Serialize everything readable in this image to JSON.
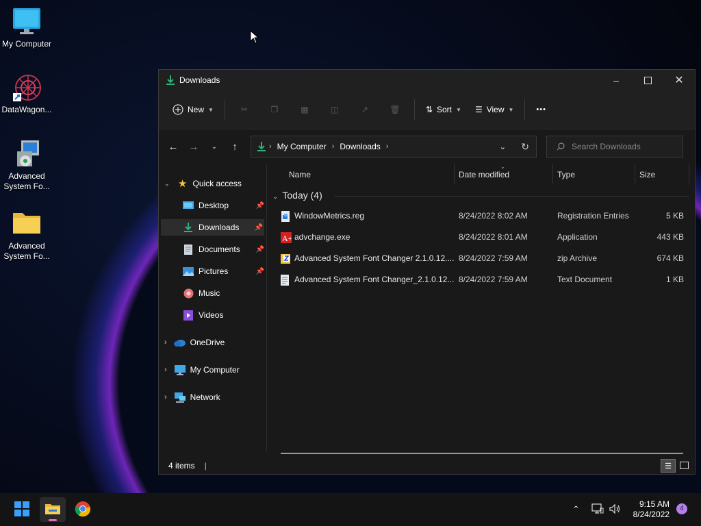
{
  "desktop": {
    "icons": [
      {
        "label": "My Computer"
      },
      {
        "label": "DataWagon..."
      },
      {
        "label": "Advanced System Fo...",
        "line1": "Advanced",
        "line2": "System Fo..."
      },
      {
        "label": "Advanced System Fo...",
        "line1": "Advanced",
        "line2": "System Fo..."
      }
    ]
  },
  "window": {
    "title": "Downloads",
    "toolbar": {
      "new_label": "New",
      "sort_label": "Sort",
      "view_label": "View",
      "more_label": "•••"
    },
    "address": {
      "crumbs": [
        "My Computer",
        "Downloads"
      ]
    },
    "search": {
      "placeholder": "Search Downloads"
    },
    "sidebar": {
      "quick_access": "Quick access",
      "pinned": [
        {
          "label": "Desktop"
        },
        {
          "label": "Downloads"
        },
        {
          "label": "Documents"
        },
        {
          "label": "Pictures"
        }
      ],
      "music": "Music",
      "videos": "Videos",
      "onedrive": "OneDrive",
      "my_computer": "My Computer",
      "network": "Network"
    },
    "columns": {
      "name": "Name",
      "date": "Date modified",
      "type": "Type",
      "size": "Size"
    },
    "group_label": "Today (4)",
    "files": [
      {
        "name": "WindowMetrics.reg",
        "date": "8/24/2022 8:02 AM",
        "type": "Registration Entries",
        "size": "5 KB",
        "icon": "registry-file-icon"
      },
      {
        "name": "advchange.exe",
        "date": "8/24/2022 8:01 AM",
        "type": "Application",
        "size": "443 KB",
        "icon": "application-icon"
      },
      {
        "name": "Advanced System Font Changer 2.1.0.12....",
        "date": "8/24/2022 7:59 AM",
        "type": "zip Archive",
        "size": "674 KB",
        "icon": "zip-archive-icon"
      },
      {
        "name": "Advanced System Font Changer_2.1.0.12...",
        "date": "8/24/2022 7:59 AM",
        "type": "Text Document",
        "size": "1 KB",
        "icon": "text-document-icon"
      }
    ],
    "status": "4 items"
  },
  "taskbar": {
    "time": "9:15 AM",
    "date": "8/24/2022",
    "notification_count": "4"
  },
  "colors": {
    "accent_green": "#2fb37a",
    "folder_yellow": "#f2c744",
    "taskbar": "#141414"
  }
}
